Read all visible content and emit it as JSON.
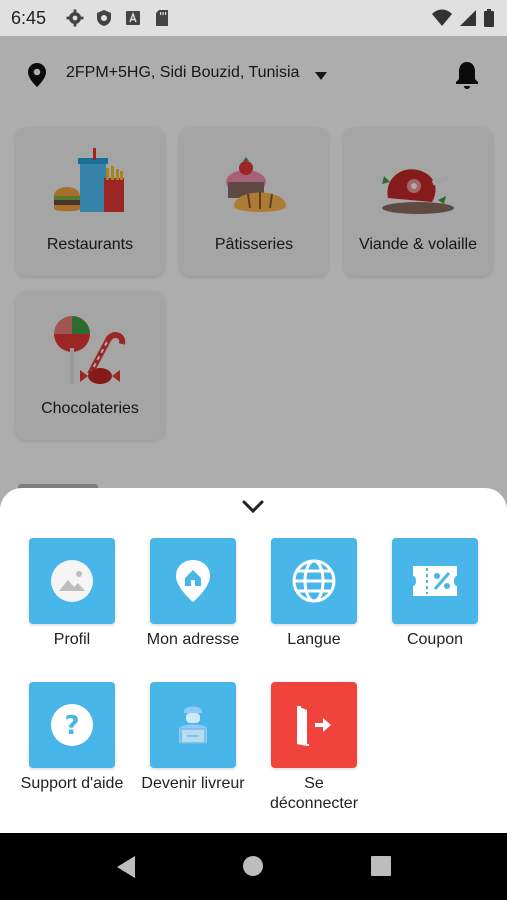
{
  "status_bar": {
    "time": "6:45",
    "icons": [
      "gear-icon",
      "shield-icon",
      "app-a-icon",
      "sd-card-icon",
      "wifi-icon",
      "signal-icon",
      "battery-icon"
    ]
  },
  "header": {
    "location": "2FPM+5HG, Sidi Bouzid, Tunisia",
    "icons": [
      "location-pin-icon",
      "caret-down-icon",
      "bell-icon"
    ]
  },
  "categories": [
    {
      "label": "Restaurants",
      "icon": "fast-food-icon"
    },
    {
      "label": "Pâtisseries",
      "icon": "pastry-icon"
    },
    {
      "label": "Viande & volaille",
      "icon": "meat-icon"
    },
    {
      "label": "Chocolateries",
      "icon": "candy-icon"
    }
  ],
  "menu": {
    "items": [
      {
        "label": "Profil",
        "icon": "profile-image-icon",
        "color": "#49b6ea"
      },
      {
        "label": "Mon adresse",
        "icon": "home-location-icon",
        "color": "#49b6ea"
      },
      {
        "label": "Langue",
        "icon": "globe-icon",
        "color": "#49b6ea"
      },
      {
        "label": "Coupon",
        "icon": "coupon-icon",
        "color": "#49b6ea"
      },
      {
        "label": "Support d'aide",
        "icon": "help-icon",
        "color": "#49b6ea"
      },
      {
        "label": "Devenir livreur",
        "icon": "delivery-person-icon",
        "color": "#49b6ea"
      },
      {
        "label": "Se\ndéconnecter",
        "icon": "logout-icon",
        "color": "#f0433b"
      }
    ]
  },
  "nav_bar": {
    "icons": [
      "back-icon",
      "home-icon",
      "recents-icon"
    ]
  }
}
